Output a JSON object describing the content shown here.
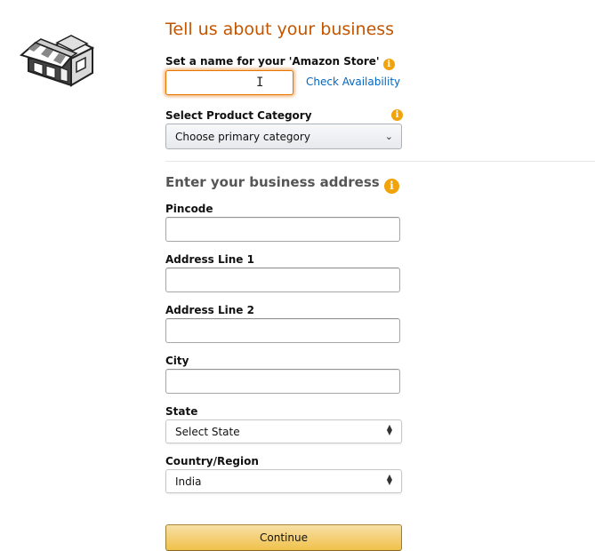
{
  "header": {
    "title": "Tell us about your business",
    "store_icon": "storefront-icon"
  },
  "store_name": {
    "label": "Set a name for your 'Amazon Store'",
    "info_icon": "info-icon",
    "value": "",
    "placeholder": "",
    "check_link": "Check Availability"
  },
  "category": {
    "label": "Select Product Category",
    "info_icon": "info-icon",
    "selected": "Choose primary category",
    "chevron_icon": "chevron-down-icon"
  },
  "address": {
    "title": "Enter your business address",
    "info_icon": "info-icon",
    "fields": [
      {
        "label": "Pincode",
        "value": ""
      },
      {
        "label": "Address Line 1",
        "value": ""
      },
      {
        "label": "Address Line 2",
        "value": ""
      },
      {
        "label": "City",
        "value": ""
      }
    ],
    "state": {
      "label": "State",
      "selected": "Select State"
    },
    "country": {
      "label": "Country/Region",
      "selected": "India"
    }
  },
  "actions": {
    "continue_label": "Continue"
  },
  "colors": {
    "title": "#c45500",
    "link": "#0066c0",
    "info": "#f0a30a",
    "focus": "#e77600",
    "button": "#f0c14b"
  }
}
